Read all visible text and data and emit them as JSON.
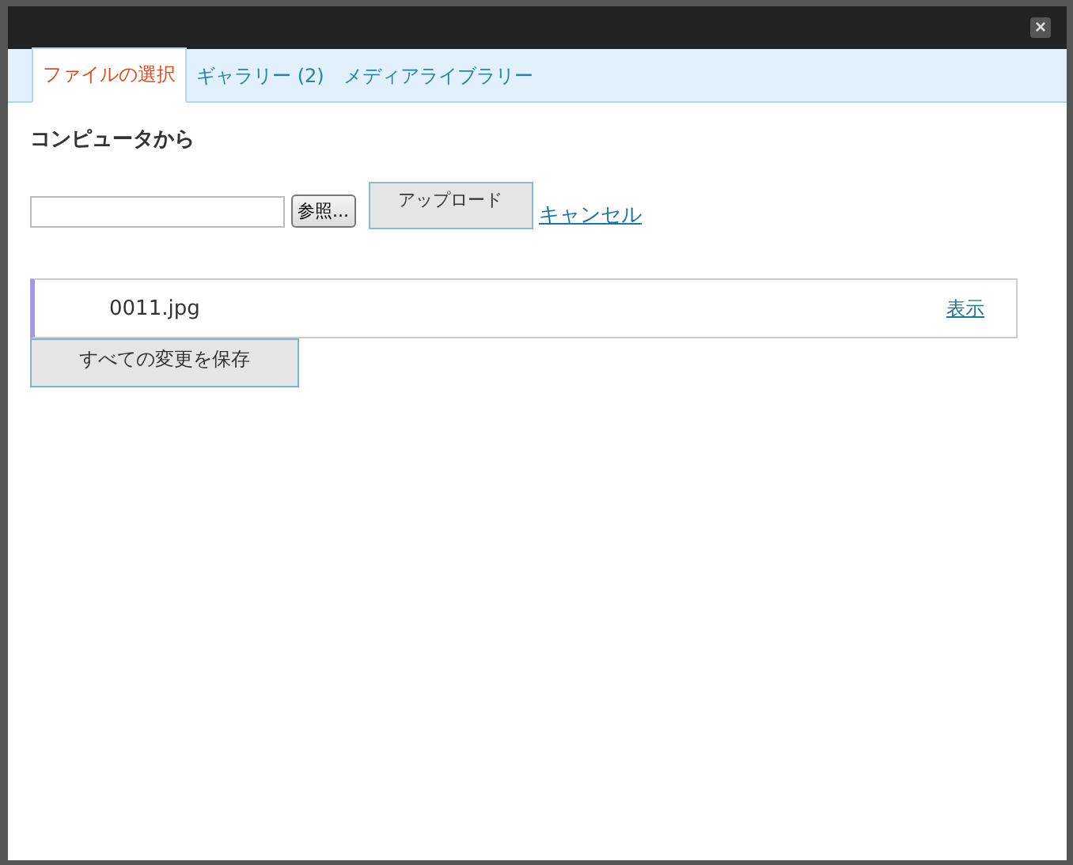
{
  "window": {
    "close_label": "×"
  },
  "tabs": [
    {
      "label": "ファイルの選択",
      "selected": true
    },
    {
      "label": "ギャラリー (2)",
      "selected": false
    },
    {
      "label": "メディアライブラリー",
      "selected": false
    }
  ],
  "section_title": "コンピュータから",
  "browse_button": "参照...",
  "upload_button": "アップロード",
  "cancel_link": "キャンセル",
  "files": [
    {
      "name": "0011.jpg",
      "link": "表示"
    }
  ],
  "save_button": "すべての変更を保存"
}
